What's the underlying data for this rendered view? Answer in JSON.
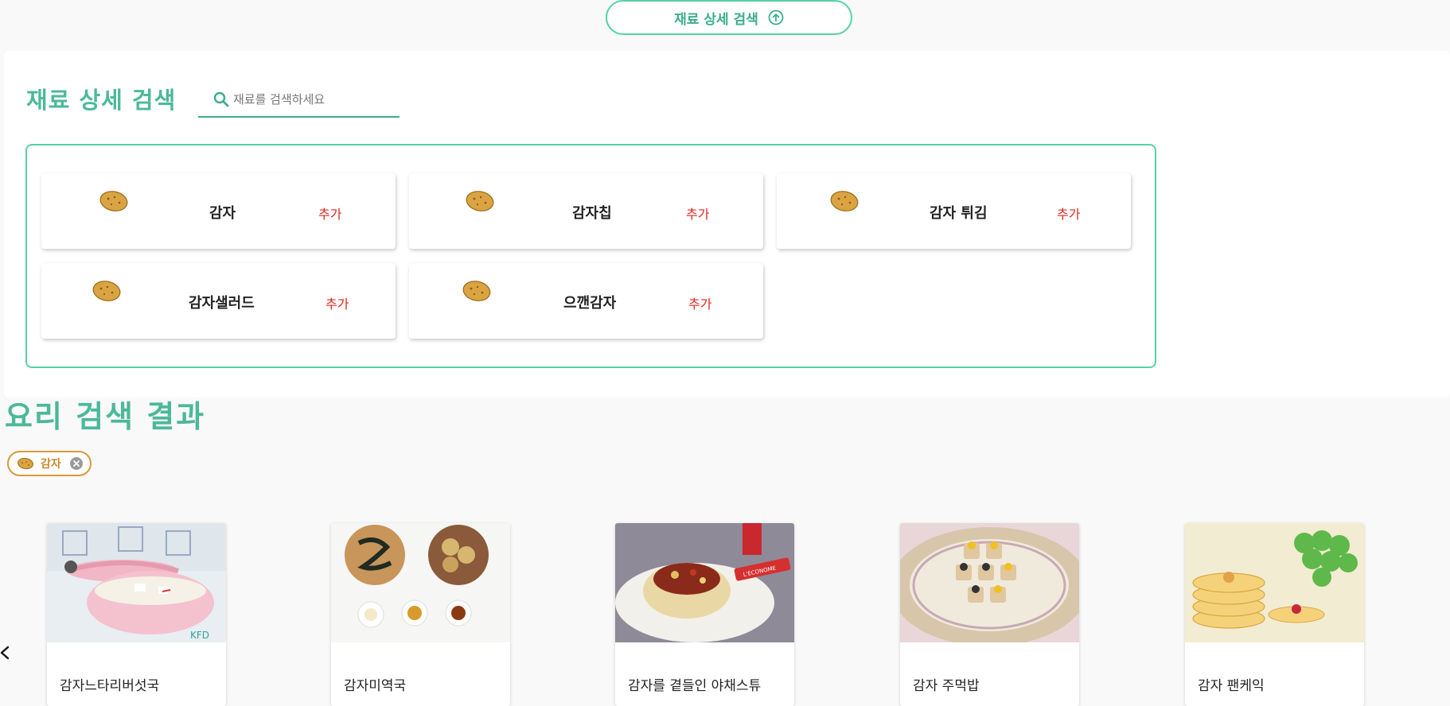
{
  "toggle": {
    "label": "재료 상세 검색",
    "icon": "arrow-up-circle-icon"
  },
  "detail_search": {
    "title": "재료 상세 검색",
    "search_placeholder": "재료를 검색하세요",
    "search_value": "",
    "results": [
      {
        "name": "감자",
        "add_label": "추가",
        "icon": "potato-icon"
      },
      {
        "name": "감자칩",
        "add_label": "추가",
        "icon": "potato-icon"
      },
      {
        "name": "감자 튀김",
        "add_label": "추가",
        "icon": "potato-icon"
      },
      {
        "name": "감자샐러드",
        "add_label": "추가",
        "icon": "potato-icon"
      },
      {
        "name": "으깬감자",
        "add_label": "추가",
        "icon": "potato-icon"
      }
    ]
  },
  "results_section": {
    "title": "요리 검색 결과",
    "selected_chips": [
      {
        "label": "감자",
        "icon": "potato-icon"
      }
    ],
    "recipes": [
      {
        "name": "감자느타리버섯국",
        "image": "pink-pot-soup"
      },
      {
        "name": "감자미역국",
        "image": "seaweed-potatoes-sauces"
      },
      {
        "name": "감자를 곁들인 야채스튜",
        "image": "stew-in-potato-basket"
      },
      {
        "name": "감자 주먹밥",
        "image": "rice-balls-on-plate"
      },
      {
        "name": "감자 팬케익",
        "image": "pancakes-with-grapes"
      }
    ]
  },
  "colors": {
    "accent": "#4cb89a",
    "border": "#55d3a3",
    "add": "#e0261b",
    "chip": "#d89a3a"
  }
}
